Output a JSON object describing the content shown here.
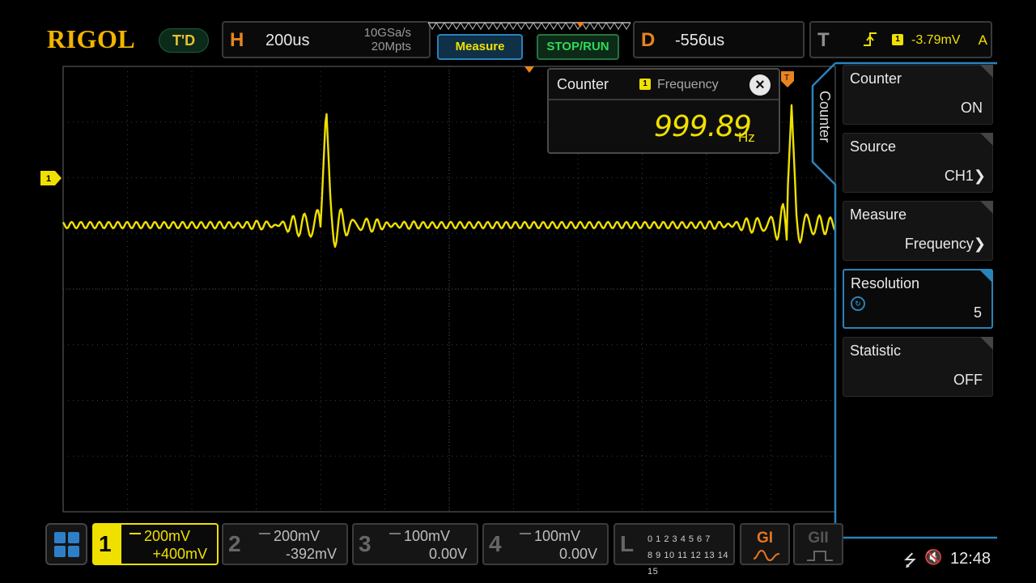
{
  "brand": {
    "logo": "RIGOL",
    "mode_badge": "T'D"
  },
  "horizontal": {
    "letter": "H",
    "timebase": "200us",
    "sample_rate": "10GSa/s",
    "memory_depth": "20Mpts"
  },
  "toolbar": {
    "measure_label": "Measure",
    "stoprun_label": "STOP/RUN"
  },
  "delay": {
    "letter": "D",
    "value": "-556us"
  },
  "trigger": {
    "letter": "T",
    "channel_chip": "1",
    "level": "-3.79mV",
    "mode": "A"
  },
  "waveform": {
    "channel_marker": "1",
    "color": "#f0e000",
    "grid_color": "#3d3d3d"
  },
  "counter_popup": {
    "title": "Counter",
    "channel_chip": "1",
    "type": "Frequency",
    "close": "×",
    "reading": "999.89",
    "unit": "Hz"
  },
  "menu": {
    "tab_label": "Counter",
    "items": [
      {
        "label": "Counter",
        "value": "ON"
      },
      {
        "label": "Source",
        "value": "CH1"
      },
      {
        "label": "Measure",
        "value": "Frequency"
      },
      {
        "label": "Resolution",
        "value": "5"
      },
      {
        "label": "Statistic",
        "value": "OFF"
      }
    ],
    "submenu_arrow": "❯"
  },
  "channels": [
    {
      "num": "1",
      "scale": "200mV",
      "offset": "+400mV",
      "color": "#f0e000"
    },
    {
      "num": "2",
      "scale": "200mV",
      "offset": "-392mV"
    },
    {
      "num": "3",
      "scale": "100mV",
      "offset": "0.00V"
    },
    {
      "num": "4",
      "scale": "100mV",
      "offset": "0.00V"
    }
  ],
  "logic": {
    "letter": "L",
    "row1": "0 1 2 3  4 5 6 7",
    "row2": "8 9 10 11 12 13 14 15"
  },
  "generators": [
    {
      "label": "GI"
    },
    {
      "label": "GII"
    }
  ],
  "status": {
    "usb_icon": "⭍",
    "mute_icon": "🔇",
    "time": "12:48"
  }
}
